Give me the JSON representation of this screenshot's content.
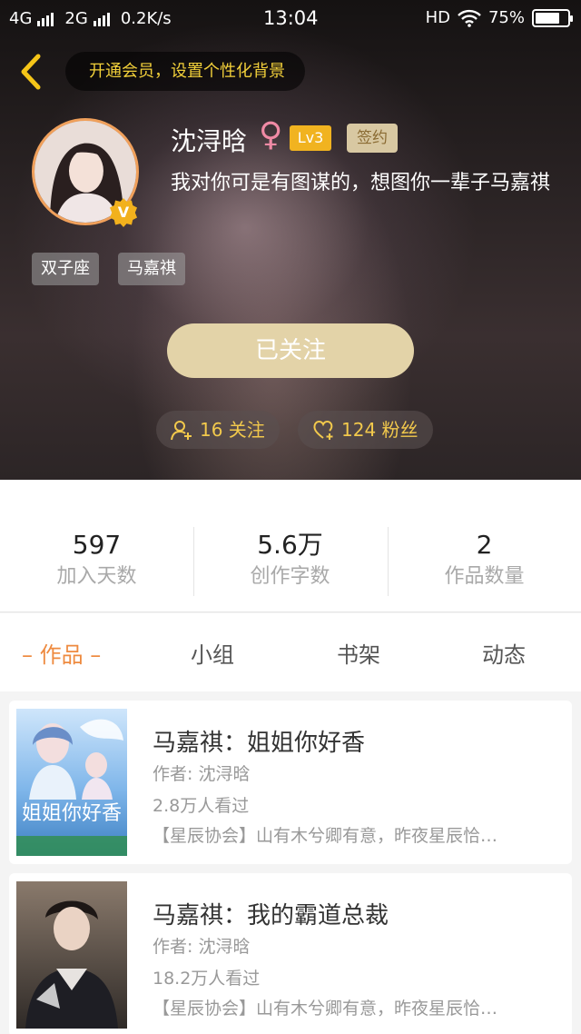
{
  "status_bar": {
    "net1": "4G",
    "net2": "2G",
    "speed": "0.2K/s",
    "time": "13:04",
    "hd": "HD",
    "battery": "75%",
    "battery_level": 0.75
  },
  "header": {
    "vip_banner": "开通会员，设置个性化背景",
    "username": "沈浔晗",
    "gender_symbol": "♀",
    "level": "Lv3",
    "sign_badge": "签约",
    "vip_mark": "V",
    "bio": "我对你可是有图谋的，想图你一辈子马嘉祺",
    "tags": [
      "双子座",
      "马嘉祺"
    ],
    "follow_button": "已关注",
    "following_label": "16 关注",
    "fans_label": "124 粉丝"
  },
  "stats": [
    {
      "value": "597",
      "label": "加入天数"
    },
    {
      "value": "5.6万",
      "label": "创作字数"
    },
    {
      "value": "2",
      "label": "作品数量"
    }
  ],
  "tabs": [
    {
      "label": "– 作品 –",
      "active": true
    },
    {
      "label": "小组",
      "active": false
    },
    {
      "label": "书架",
      "active": false
    },
    {
      "label": "动态",
      "active": false
    }
  ],
  "works": [
    {
      "title": "马嘉祺：姐姐你好香",
      "author": "作者: 沈浔晗",
      "views": "2.8万人看过",
      "desc": "【星辰协会】山有木兮卿有意，昨夜星辰恰…",
      "cover_text": "姐姐你好香"
    },
    {
      "title": "马嘉祺：我的霸道总裁",
      "author": "作者: 沈浔晗",
      "views": "18.2万人看过",
      "desc": "【星辰协会】山有木兮卿有意，昨夜星辰恰…"
    }
  ],
  "colors": {
    "accent_orange": "#ee8a3f",
    "gold": "#f2c94c",
    "follow_button": "#e3d3a8"
  }
}
